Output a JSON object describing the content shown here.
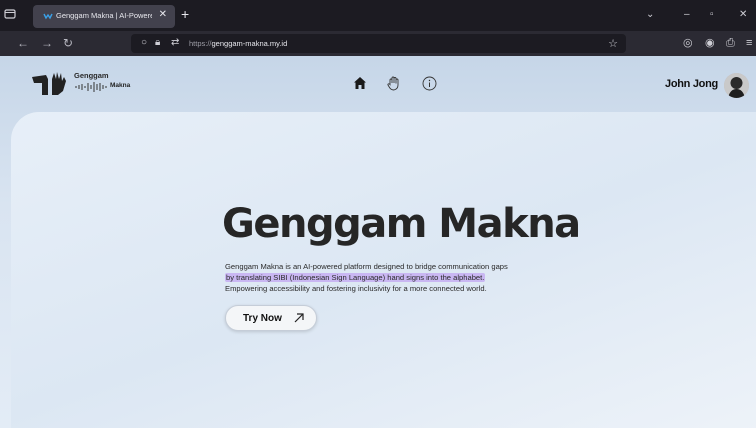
{
  "browser": {
    "tab_title": "Genggam Makna | AI-Powered",
    "tab_close": "✕",
    "new_tab": "+",
    "url_protocol": "https://",
    "url_host": "genggam-makna.my.id"
  },
  "site": {
    "logo_text": "Genggam",
    "logo_sub": "Makna",
    "nav_icons": [
      "home-icon",
      "hand-icon",
      "info-icon"
    ],
    "user_name": "John Jong"
  },
  "hero": {
    "title": "Genggam Makna",
    "line1": "Genggam Makna is an AI-powered platform designed to bridge communication gaps",
    "line2_highlight": "by translating SIBI (Indonesian Sign Language) hand signs into the alphabet.",
    "line3": "Empowering accessibility and fostering inclusivity for a more connected world.",
    "cta_label": "Try Now"
  },
  "colors": {
    "highlight": "#c9b7f2",
    "chrome_dark": "#1c1b22",
    "page_bg": "#dce7f3"
  }
}
